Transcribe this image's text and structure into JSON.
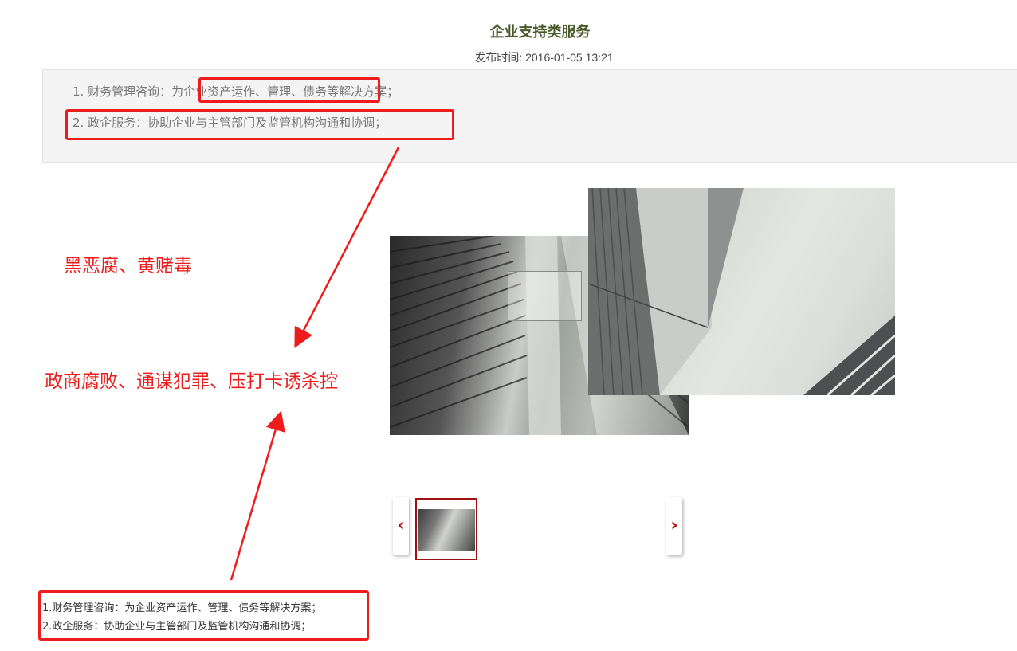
{
  "article": {
    "title": "企业支持类服务",
    "publish_time": "发布时间: 2016-01-05 13:21"
  },
  "summary": {
    "items": [
      "1. 财务管理咨询：为企业资产运作、管理、债务等解决方案；",
      "2. 政企服务：协助企业与主管部门及监管机构沟通和协调；"
    ]
  },
  "annotations": {
    "note_1": "黑恶腐、黄赌毒",
    "note_2": "政商腐败、通谋犯罪、压打卡诱杀控",
    "color": "#ee1c1c"
  },
  "gallery": {
    "prev_icon": "chevron-left-icon",
    "next_icon": "chevron-right-icon",
    "prev_glyph": "‹",
    "next_glyph": "›",
    "thumbnails": 1,
    "accent_color": "#a01010"
  },
  "body": {
    "lines": [
      "1.财务管理咨询：为企业资产运作、管理、债务等解决方案；",
      "2.政企服务：协助企业与主管部门及监管机构沟通和协调；"
    ]
  }
}
